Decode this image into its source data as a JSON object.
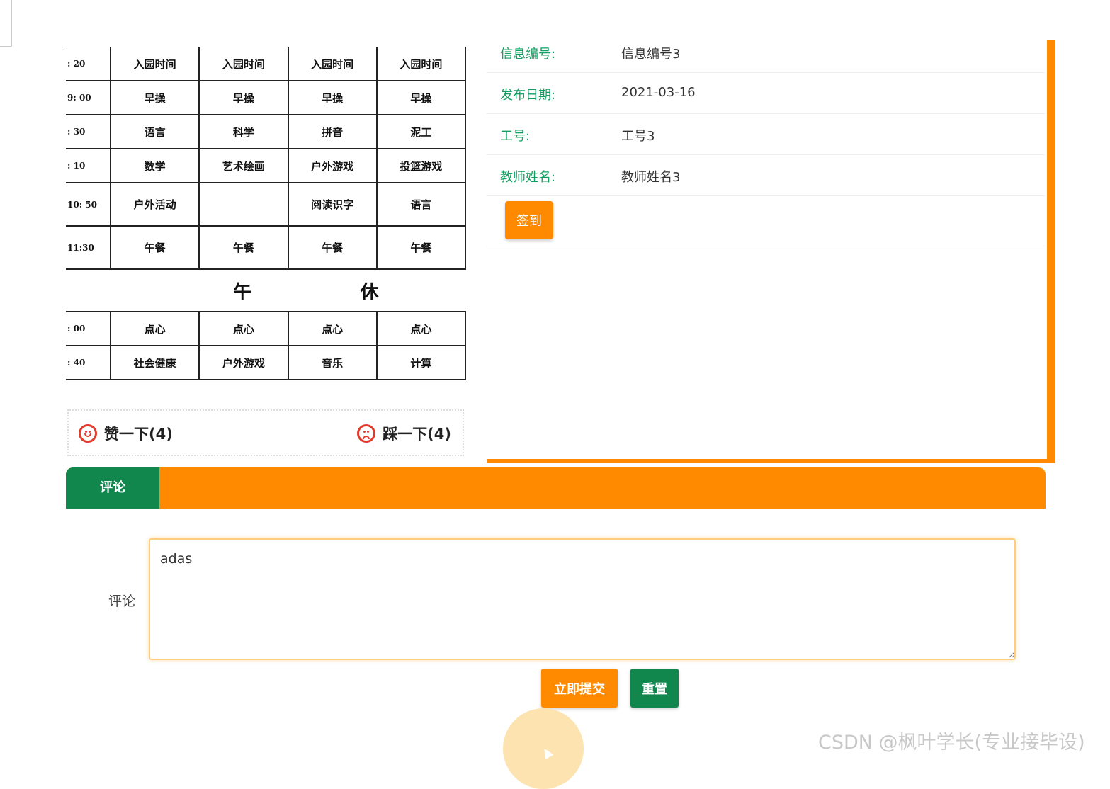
{
  "schedule": {
    "rows": [
      {
        "time": ": 20",
        "cells": [
          "入园时间",
          "入园时间",
          "入园时间",
          "入园时间"
        ]
      },
      {
        "time": "9: 00",
        "cells": [
          "早操",
          "早操",
          "早操",
          "早操"
        ]
      },
      {
        "time": ": 30",
        "cells": [
          "语言",
          "科学",
          "拼音",
          "泥工"
        ]
      },
      {
        "time": ": 10",
        "cells": [
          "数学",
          "艺术绘画",
          "户外游戏",
          "投篮游戏"
        ]
      },
      {
        "time": "10: 50",
        "cells": [
          "户外活动",
          "",
          "阅读识字",
          "语言"
        ]
      },
      {
        "time": "11:30",
        "cells": [
          "午餐",
          "午餐",
          "午餐",
          "午餐"
        ]
      }
    ],
    "noon_left": "午",
    "noon_right": "休",
    "afternoon_rows": [
      {
        "time": ": 00",
        "cells": [
          "点心",
          "点心",
          "点心",
          "点心"
        ]
      },
      {
        "time": ": 40",
        "cells": [
          "社会健康",
          "户外游戏",
          "音乐",
          "计算"
        ]
      }
    ]
  },
  "votes": {
    "up_label": "赞一下(4)",
    "down_label": "踩一下(4)"
  },
  "info": {
    "rows": [
      {
        "label": "信息编号:",
        "value": "信息编号3"
      },
      {
        "label": "发布日期:",
        "value": "2021-03-16"
      },
      {
        "label": "工号:",
        "value": "工号3"
      },
      {
        "label": "教师姓名:",
        "value": "教师姓名3"
      }
    ],
    "signin_label": "签到"
  },
  "comment": {
    "tab_label": "评论",
    "form_label": "评论",
    "textarea_value": "adas",
    "submit_label": "立即提交",
    "reset_label": "重置"
  },
  "watermark": "CSDN @枫叶学长(专业接毕设)",
  "colors": {
    "accent_orange": "#ff8a00",
    "accent_green": "#11874e",
    "label_green": "#11a060"
  }
}
